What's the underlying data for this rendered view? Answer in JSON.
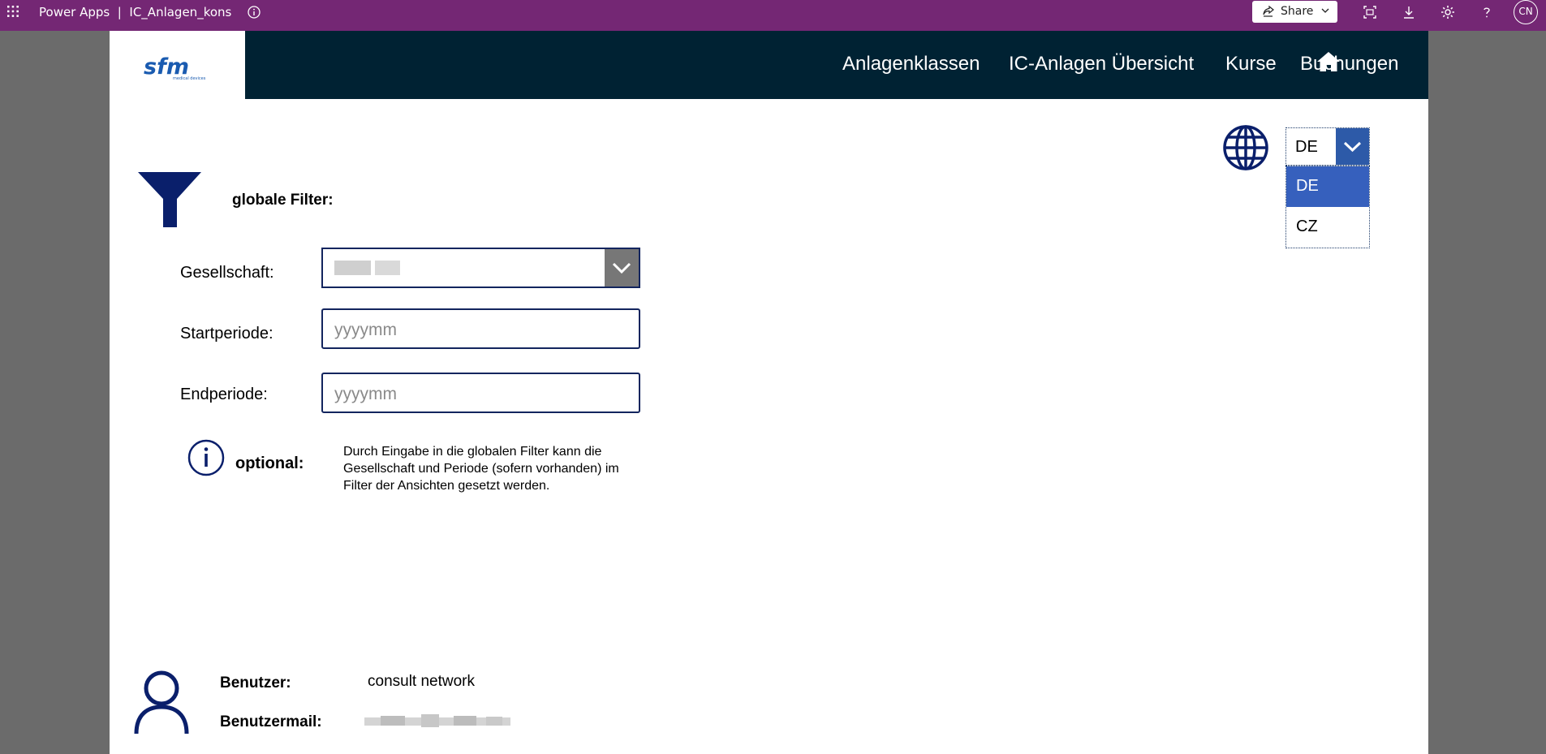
{
  "titlebar": {
    "app_name": "Power Apps",
    "separator": "|",
    "app_file": "IC_Anlagen_kons",
    "share_label": "Share",
    "avatar_initials": "CN",
    "background_color": "#742774"
  },
  "nav": {
    "logo_text": "sfm",
    "logo_subtext": "medical devices",
    "items": [
      {
        "label": "Anlagenklassen"
      },
      {
        "label": "IC-Anlagen Übersicht"
      },
      {
        "label": "Kurse"
      },
      {
        "label": "Buchungen"
      }
    ],
    "background_color": "#002233"
  },
  "language": {
    "selected": "DE",
    "options": [
      "DE",
      "CZ"
    ],
    "highlight_color": "#3660bd"
  },
  "filter": {
    "title": "globale Filter:",
    "company_label": "Gesellschaft:",
    "start_label": "Startperiode:",
    "start_placeholder": "yyyymm",
    "end_label": "Endperiode:",
    "end_placeholder": "yyyymm"
  },
  "optional": {
    "label": "optional:",
    "text": "Durch Eingabe in die globalen Filter kann die Gesellschaft und Periode (sofern vorhanden) im Filter der Ansichten gesetzt werden."
  },
  "user": {
    "user_label": "Benutzer:",
    "user_value": "consult network",
    "mail_label": "Benutzermail:"
  },
  "theme": {
    "accent": "#13255e",
    "icon_color": "#0a1f6b"
  }
}
